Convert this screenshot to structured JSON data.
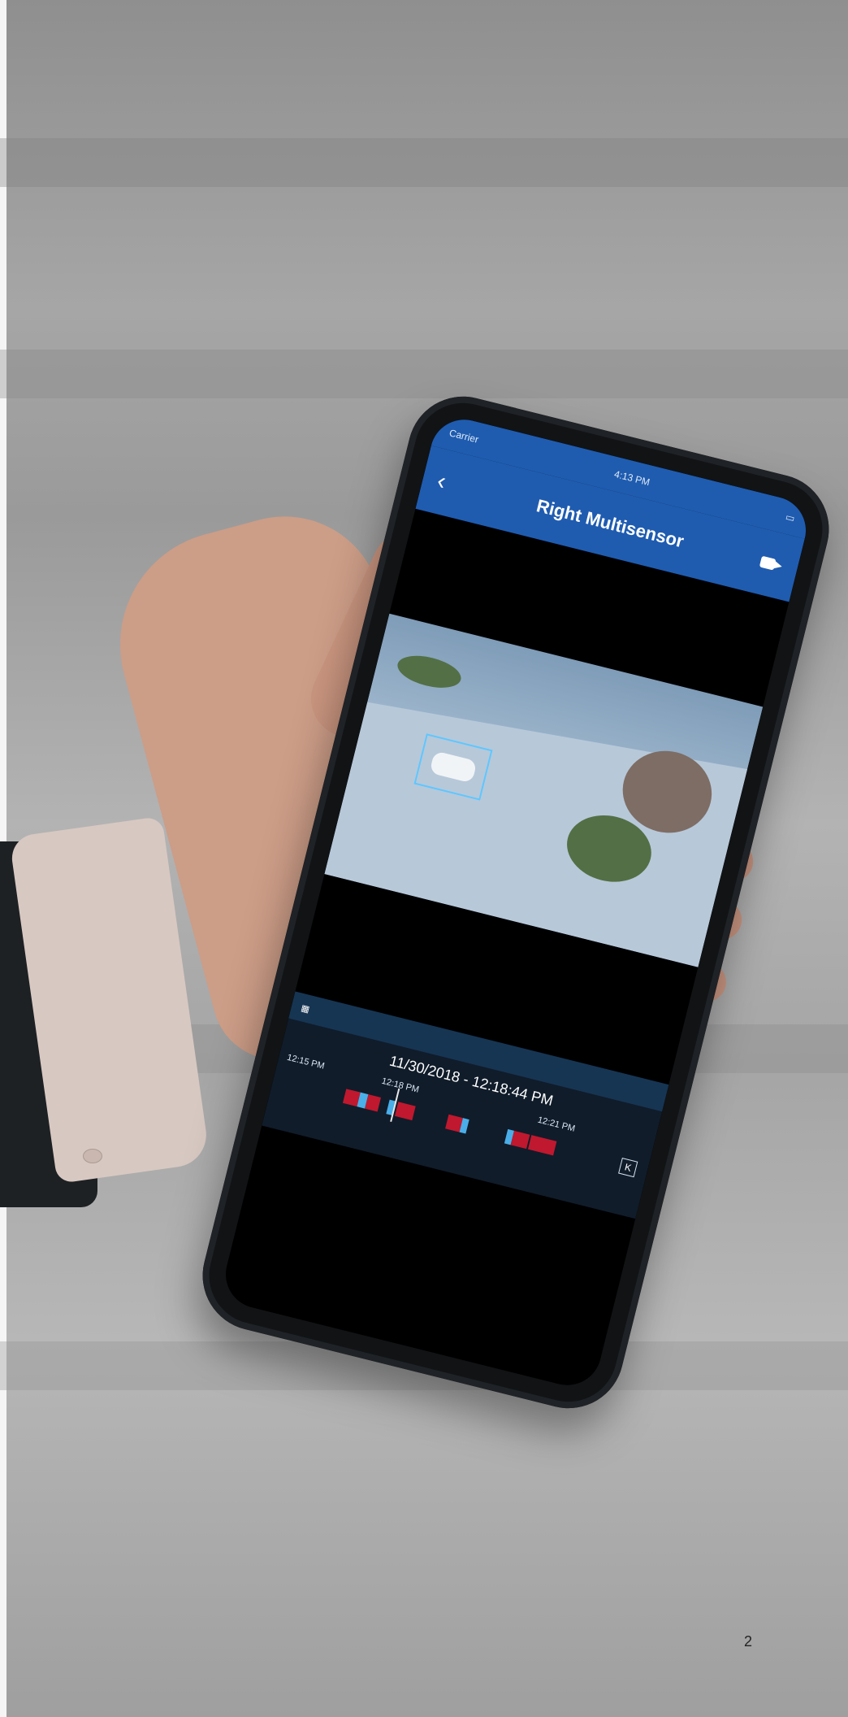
{
  "status_bar": {
    "carrier": "Carrier",
    "time": "4:13 PM"
  },
  "header": {
    "title": "Right Multisensor"
  },
  "playback": {
    "timestamp": "11/30/2018 - 12:18:44 PM",
    "tick_labels": [
      "12:15 PM",
      "12:18 PM",
      "12:21 PM"
    ]
  },
  "page": {
    "number": "2"
  },
  "colors": {
    "app_bar": "#1f5cb0",
    "timeline_red": "#c0182e",
    "timeline_blue": "#4aaee8"
  },
  "icons": {
    "back": "back-icon",
    "camera": "camera-icon",
    "calendar": "calendar-icon",
    "collapse": "collapse-icon"
  }
}
